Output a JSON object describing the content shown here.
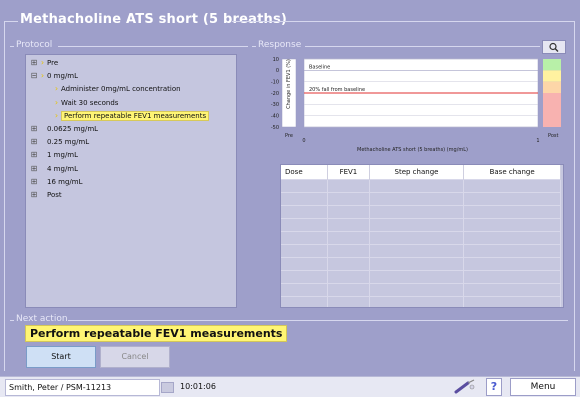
{
  "window": {
    "title": "Methacholine ATS short (5 breaths)"
  },
  "protocol": {
    "legend": "Protocol",
    "items": [
      {
        "label": "Pre",
        "level": 0,
        "expander": "⊞",
        "arrow": "›"
      },
      {
        "label": "0 mg/mL",
        "level": 0,
        "expander": "⊟",
        "arrow": "›"
      },
      {
        "label": "Administer 0mg/mL concentration",
        "level": 1,
        "expander": "",
        "arrow": "›"
      },
      {
        "label": "Wait 30 seconds",
        "level": 1,
        "expander": "",
        "arrow": "›"
      },
      {
        "label": "Perform repeatable FEV1 measurements",
        "level": 1,
        "expander": "",
        "arrow": "›",
        "selected": true
      },
      {
        "label": "0.0625 mg/mL",
        "level": 0,
        "expander": "⊞",
        "arrow": ""
      },
      {
        "label": "0.25 mg/mL",
        "level": 0,
        "expander": "⊞",
        "arrow": ""
      },
      {
        "label": "1 mg/mL",
        "level": 0,
        "expander": "⊞",
        "arrow": ""
      },
      {
        "label": "4 mg/mL",
        "level": 0,
        "expander": "⊞",
        "arrow": ""
      },
      {
        "label": "16 mg/mL",
        "level": 0,
        "expander": "⊞",
        "arrow": ""
      },
      {
        "label": "Post",
        "level": 0,
        "expander": "⊞",
        "arrow": ""
      }
    ]
  },
  "response": {
    "legend": "Response",
    "zoom_icon": "magnifier-icon",
    "chart": {
      "ylabel": "Change in FEV1 (%)",
      "yticks": [
        "10",
        "0",
        "-10",
        "-20",
        "-30",
        "-40",
        "-50"
      ],
      "pre_label": "Pre",
      "post_label": "Post",
      "xtick_left": "0",
      "xtick_right": "1",
      "xlabel": "Methacholine ATS short (5 breaths) (mg/mL)",
      "baseline_label": "Baseline",
      "threshold_label": "20% fall from baseline"
    },
    "table": {
      "headers": [
        "Dose",
        "FEV1",
        "Step change",
        "Base change"
      ],
      "empty_rows": 12
    }
  },
  "next_action": {
    "legend": "Next action",
    "text": "Perform repeatable FEV1 measurements"
  },
  "buttons": {
    "start": "Start",
    "cancel": "Cancel"
  },
  "status_bar": {
    "patient": "Smith, Peter / PSM-11213",
    "time": "10:01:06",
    "menu": "Menu",
    "help_glyph": "?"
  },
  "chart_data": {
    "type": "line",
    "title": "",
    "xlabel": "Methacholine ATS short (5 breaths) (mg/mL)",
    "ylabel": "Change in FEV1 (%)",
    "xlim": [
      0,
      1
    ],
    "ylim": [
      -50,
      10
    ],
    "series": [],
    "reference_lines": [
      {
        "label": "Baseline",
        "y": 0,
        "color": "#ffffff"
      },
      {
        "label": "20% fall from baseline",
        "y": -20,
        "color": "#e03030"
      }
    ],
    "colors": {
      "green": "#b8f0a8",
      "yellow": "#fff2a0",
      "orange": "#fdd6a8",
      "red": "#f8b2b0"
    }
  }
}
